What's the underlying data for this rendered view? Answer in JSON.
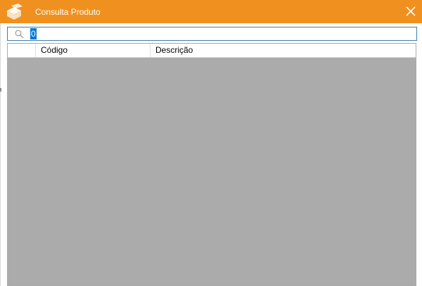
{
  "window": {
    "title": "Consulta Produto",
    "close_icon": "close-icon",
    "logo_icon": "app-logo-icon",
    "title_bar_color": "#f0901f"
  },
  "search": {
    "icon": "search-icon",
    "value": "0"
  },
  "grid": {
    "columns": [
      {
        "label": ""
      },
      {
        "label": "Código"
      },
      {
        "label": "Descrição"
      }
    ],
    "rows": [],
    "empty_area_color": "#ababab"
  }
}
